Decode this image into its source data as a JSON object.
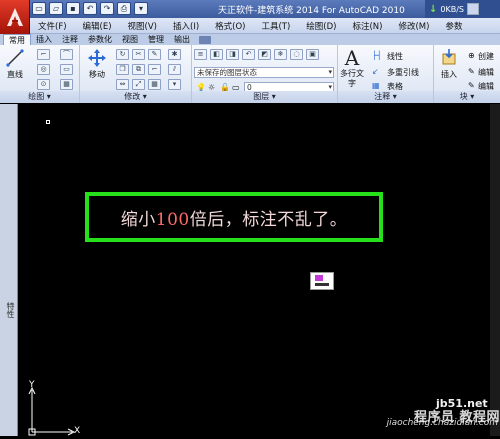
{
  "titlebar": {
    "title": "天正软件-建筑系统 2014  For AutoCAD 2010",
    "transfer_speed": "0KB/S",
    "accent_color": "#3d5c9e"
  },
  "menubar": {
    "items": [
      "文件(F)",
      "编辑(E)",
      "视图(V)",
      "插入(I)",
      "格式(O)",
      "工具(T)",
      "绘图(D)",
      "标注(N)",
      "修改(M)",
      "参数"
    ]
  },
  "ribbon_tabs": {
    "items": [
      "常用",
      "插入",
      "注释",
      "参数化",
      "视图",
      "管理",
      "输出"
    ],
    "active": "常用"
  },
  "ribbon": {
    "draw": {
      "line_label": "直线",
      "panel_label": "绘图 ▾"
    },
    "modify": {
      "move_label": "移动",
      "panel_label": "修改 ▾"
    },
    "layers": {
      "layer_state": "未保存的图层状态",
      "layer_value": "0",
      "panel_label": "图层 ▾"
    },
    "annotation": {
      "multiline_text_label": "多行文字",
      "linear_label": "线性",
      "multileader_label": "多重引线",
      "table_label": "表格",
      "panel_label": "注释 ▾"
    },
    "block": {
      "insert_label": "插入",
      "create_label": "创建",
      "edit_label": "编辑",
      "edit_attr_label": "编辑",
      "panel_label": "块 ▾"
    }
  },
  "sidebar": {
    "label": "特性"
  },
  "canvas": {
    "note_text_before": "缩小",
    "note_number": "100",
    "note_text_after": "倍后，标注不乱了。",
    "note_border_color": "#25e01b",
    "ucs_y": "Y",
    "ucs_x": "X"
  },
  "watermark": {
    "site": "jb51.net",
    "line1": "程序员 教程网",
    "line2": "jiaocheng.chazidian.com"
  }
}
